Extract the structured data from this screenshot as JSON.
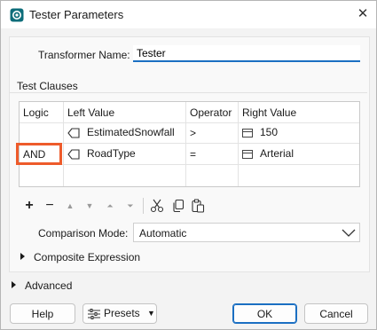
{
  "window": {
    "title": "Tester Parameters",
    "close_label": "✕"
  },
  "transformer": {
    "name_label": "Transformer Name:",
    "name_value": "Tester"
  },
  "test_clauses": {
    "group_label": "Test Clauses",
    "columns": [
      "Logic",
      "Left Value",
      "Operator",
      "Right Value"
    ],
    "rows": [
      {
        "logic": "",
        "left_value": "EstimatedSnowfall",
        "operator": ">",
        "right_value": "150"
      },
      {
        "logic": "AND",
        "left_value": "RoadType",
        "operator": "=",
        "right_value": "Arterial"
      }
    ],
    "toolbar": [
      "add-icon",
      "remove-icon",
      "move-up-icon",
      "move-down-icon",
      "move-top-icon",
      "move-bottom-icon",
      "cut-icon",
      "copy-icon",
      "paste-icon"
    ],
    "comparison_mode_label": "Comparison Mode:",
    "comparison_mode_value": "Automatic",
    "composite_expression_label": "Composite Expression"
  },
  "advanced_label": "Advanced",
  "buttons": {
    "help": "Help",
    "presets": "Presets",
    "ok": "OK",
    "cancel": "Cancel"
  },
  "colors": {
    "accent": "#1b6fc2",
    "highlight": "#ee5b2b"
  }
}
